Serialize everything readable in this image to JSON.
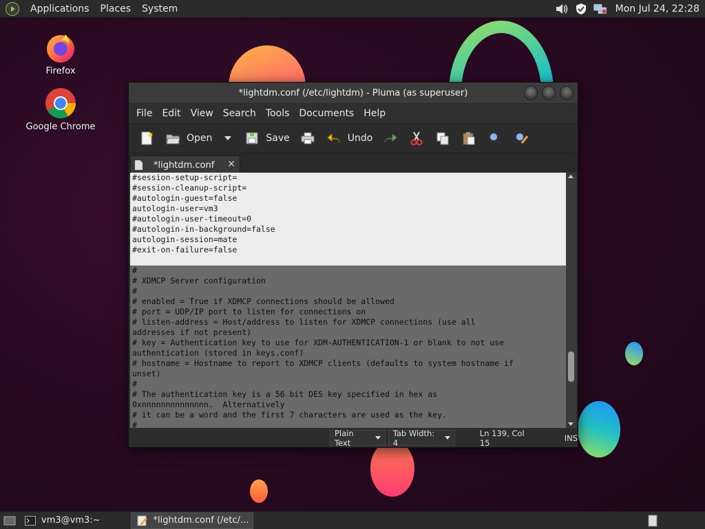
{
  "panel": {
    "menus": [
      "Applications",
      "Places",
      "System"
    ],
    "clock": "Mon Jul 24, 22:28",
    "tray_icons": [
      "volume-icon",
      "shield-icon",
      "network-icon"
    ]
  },
  "desktop": {
    "icons": [
      {
        "label": "Firefox",
        "icon": "firefox-icon"
      },
      {
        "label": "Google Chrome",
        "icon": "chrome-icon"
      }
    ]
  },
  "window": {
    "title": "*lightdm.conf (/etc/lightdm) - Pluma (as superuser)",
    "menubar": [
      "File",
      "Edit",
      "View",
      "Search",
      "Tools",
      "Documents",
      "Help"
    ],
    "toolbar": {
      "open_label": "Open",
      "save_label": "Save",
      "undo_label": "Undo"
    },
    "tab": {
      "label": "*lightdm.conf"
    },
    "editor_lines_light": [
      "#session-setup-script=",
      "#session-cleanup-script=",
      "#autologin-guest=false",
      "autologin-user=vm3",
      "#autologin-user-timeout=0",
      "#autologin-in-background=false",
      "autologin-session=mate",
      "#exit-on-failure=false",
      ""
    ],
    "editor_lines_dark": [
      "#",
      "# XDMCP Server configuration",
      "#",
      "# enabled = True if XDMCP connections should be allowed",
      "# port = UDP/IP port to listen for connections on",
      "# listen-address = Host/address to listen for XDMCP connections (use all",
      "addresses if not present)",
      "# key = Authentication key to use for XDM-AUTHENTICATION-1 or blank to not use",
      "authentication (stored in keys.conf)",
      "# hostname = Hostname to report to XDMCP clients (defaults to system hostname if",
      "unset)",
      "#",
      "# The authentication key is a 56 bit DES key specified in hex as",
      "0xnnnnnnnnnnnnnn.  Alternatively",
      "# it can be a word and the first 7 characters are used as the key.",
      "#"
    ],
    "status": {
      "syntax": "Plain Text",
      "tab_width": "Tab Width:  4",
      "position": "Ln 139, Col 15",
      "mode": "INS"
    }
  },
  "taskbar": {
    "items": [
      {
        "label": "vm3@vm3:~",
        "active": false
      },
      {
        "label": "*lightdm.conf (/etc/...",
        "active": true
      }
    ]
  }
}
